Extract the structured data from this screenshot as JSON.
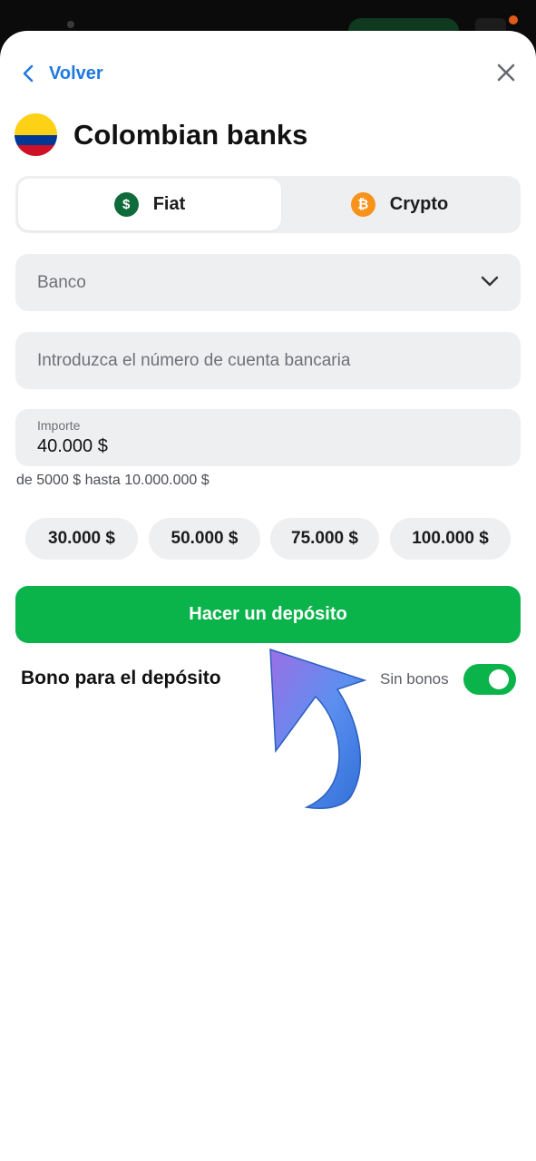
{
  "header": {
    "back_label": "Volver",
    "title": "Colombian banks"
  },
  "tabs": [
    {
      "label": "Fiat",
      "icon": "dollar-coin-icon",
      "icon_glyph": "$",
      "color": "#0f6b3a",
      "active": true
    },
    {
      "label": "Crypto",
      "icon": "bitcoin-icon",
      "icon_glyph": "₿",
      "color": "#f7931a",
      "active": false
    }
  ],
  "form": {
    "bank_select_value": "Banco",
    "account_placeholder": "Introduzca el número de cuenta bancaria",
    "amount_label": "Importe",
    "amount_value": "40.000 $",
    "range_text": "de 5000 $ hasta 10.000.000 $"
  },
  "quick_amounts": [
    "30.000 $",
    "50.000 $",
    "75.000 $",
    "100.000 $"
  ],
  "deposit_button": "Hacer un depósito",
  "bonus": {
    "label": "Bono para el depósito",
    "state_text": "Sin bonos",
    "enabled": true
  },
  "colors": {
    "accent_green": "#0bb34b",
    "link_blue": "#1f7ae0",
    "flag": [
      "#fcd116",
      "#003893",
      "#ce1126"
    ]
  }
}
